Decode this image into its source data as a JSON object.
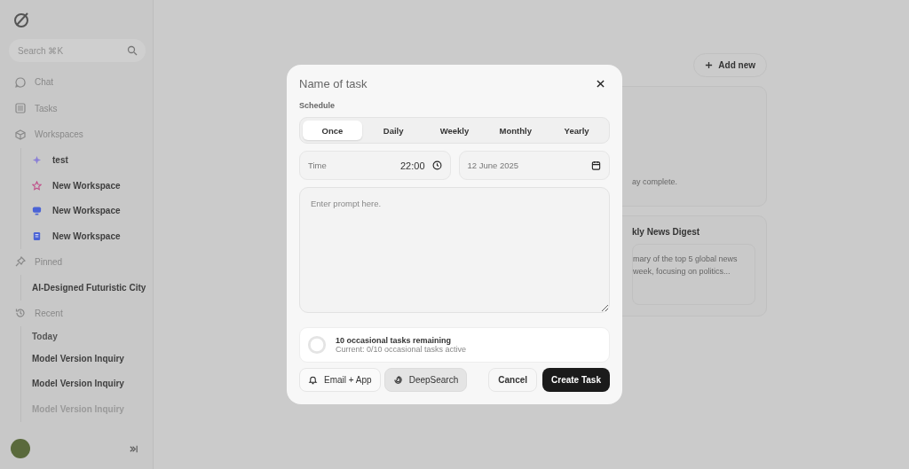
{
  "sidebar": {
    "search": {
      "placeholder": "Search ⌘K"
    },
    "nav": [
      "Chat",
      "Tasks",
      "Workspaces"
    ],
    "workspaces": [
      {
        "label": "test",
        "color": "#8a7fd6"
      },
      {
        "label": "New Workspace",
        "color": "#c0508a"
      },
      {
        "label": "New Workspace",
        "color": "#4a63d6"
      },
      {
        "label": "New Workspace",
        "color": "#4a63d6"
      }
    ],
    "pinned": {
      "label": "Pinned",
      "items": [
        "AI-Designed Futuristic City"
      ]
    },
    "recent": {
      "label": "Recent",
      "group": "Today",
      "items": [
        {
          "label": "Model Version Inquiry",
          "faded": false
        },
        {
          "label": "Model Version Inquiry",
          "faded": false
        },
        {
          "label": "Model Version Inquiry",
          "faded": true
        }
      ]
    }
  },
  "main": {
    "add_button": "Add new",
    "cards": [
      {
        "text": [
          "ay complete."
        ]
      },
      {
        "title": "kly News Digest",
        "text": [
          "mary of the top 5 global news",
          "week, focusing on politics..."
        ]
      }
    ]
  },
  "dialog": {
    "title": "Name of task",
    "schedule_label": "Schedule",
    "schedule": [
      {
        "label": "Once",
        "selected": true
      },
      {
        "label": "Daily",
        "selected": false
      },
      {
        "label": "Weekly",
        "selected": false
      },
      {
        "label": "Monthly",
        "selected": false
      },
      {
        "label": "Yearly",
        "selected": false
      }
    ],
    "time": {
      "label": "Time",
      "value": "22:00"
    },
    "date": {
      "value": "12 June 2025"
    },
    "prompt": {
      "placeholder": "Enter prompt here."
    },
    "quota": {
      "title": "10 occasional tasks remaining",
      "subtitle": "Current: 0/10 occasional tasks active",
      "level": 0
    },
    "toggles": [
      {
        "label": "Email + App",
        "on": false
      },
      {
        "label": "DeepSearch",
        "on": true
      }
    ],
    "cancel": "Cancel",
    "submit": "Create Task"
  }
}
